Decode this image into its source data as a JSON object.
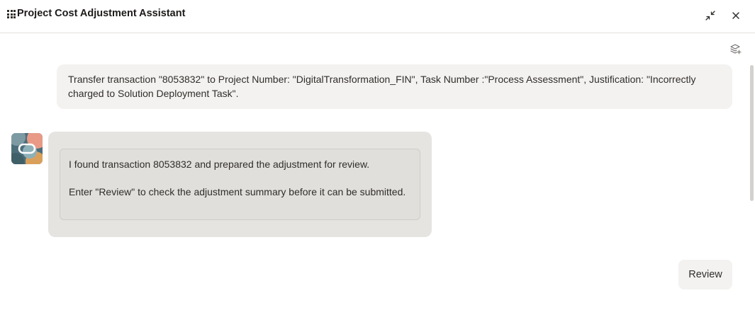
{
  "header": {
    "title": "Project Cost Adjustment Assistant",
    "menu_icon": "grid-menu-icon",
    "minimize_icon": "minimize-icon",
    "close_icon": "close-icon"
  },
  "toolbar": {
    "layers_icon": "layers-add-icon"
  },
  "conversation": {
    "user_message": "Transfer transaction \"8053832\" to Project Number: \"DigitalTransformation_FIN\", Task Number :\"Process Assessment\", Justification: \"Incorrectly charged to Solution Deployment Task\".",
    "bot_message": {
      "line1": "I found transaction 8053832 and prepared the adjustment for review.",
      "line2": "Enter \"Review\" to check the adjustment summary before it can be submitted."
    },
    "quick_reply": "Review"
  },
  "colors": {
    "user_bubble": "#f3f2f1",
    "bot_bubble": "#e6e4e1",
    "bot_card": "#e0dfdb",
    "text": "#312d2a"
  }
}
